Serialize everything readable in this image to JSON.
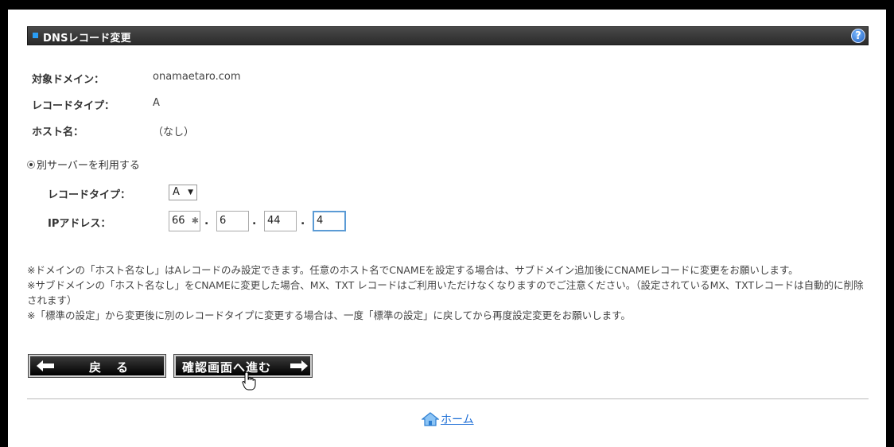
{
  "header": {
    "title": "DNSレコード変更",
    "help_symbol": "?"
  },
  "info": {
    "domain_label": "対象ドメイン：",
    "domain_value": "onamaetaro.com",
    "record_type_label": "レコードタイプ：",
    "record_type_value": "A",
    "host_label": "ホスト名：",
    "host_value": "（なし）"
  },
  "option": {
    "radio_label": "別サーバーを利用する",
    "record_type_label": "レコードタイプ：",
    "record_type_selected": "A",
    "ip_label": "IPアドレス：",
    "ip_octets": [
      "66",
      "6",
      "44",
      "4"
    ],
    "ip_separator": "."
  },
  "notes": [
    "※ドメインの「ホスト名なし」はAレコードのみ設定できます。任意のホスト名でCNAMEを設定する場合は、サブドメイン追加後にCNAMEレコードに変更をお願いします。",
    "※サブドメインの「ホスト名なし」をCNAMEに変更した場合、MX、TXT レコードはご利用いただけなくなりますのでご注意ください。（設定されているMX、TXTレコードは自動的に削除されます）",
    "※「標準の設定」から変更後に別のレコードタイプに変更する場合は、一度「標準の設定」に戻してから再度設定変更をお願いします。"
  ],
  "buttons": {
    "back_label": "戻　る",
    "confirm_label": "確認画面へ進む"
  },
  "footer": {
    "home_label": "ホーム"
  },
  "colors": {
    "header_bg": "#2b2b2b",
    "accent_blue": "#2a9df4",
    "link": "#1f6fd6"
  }
}
